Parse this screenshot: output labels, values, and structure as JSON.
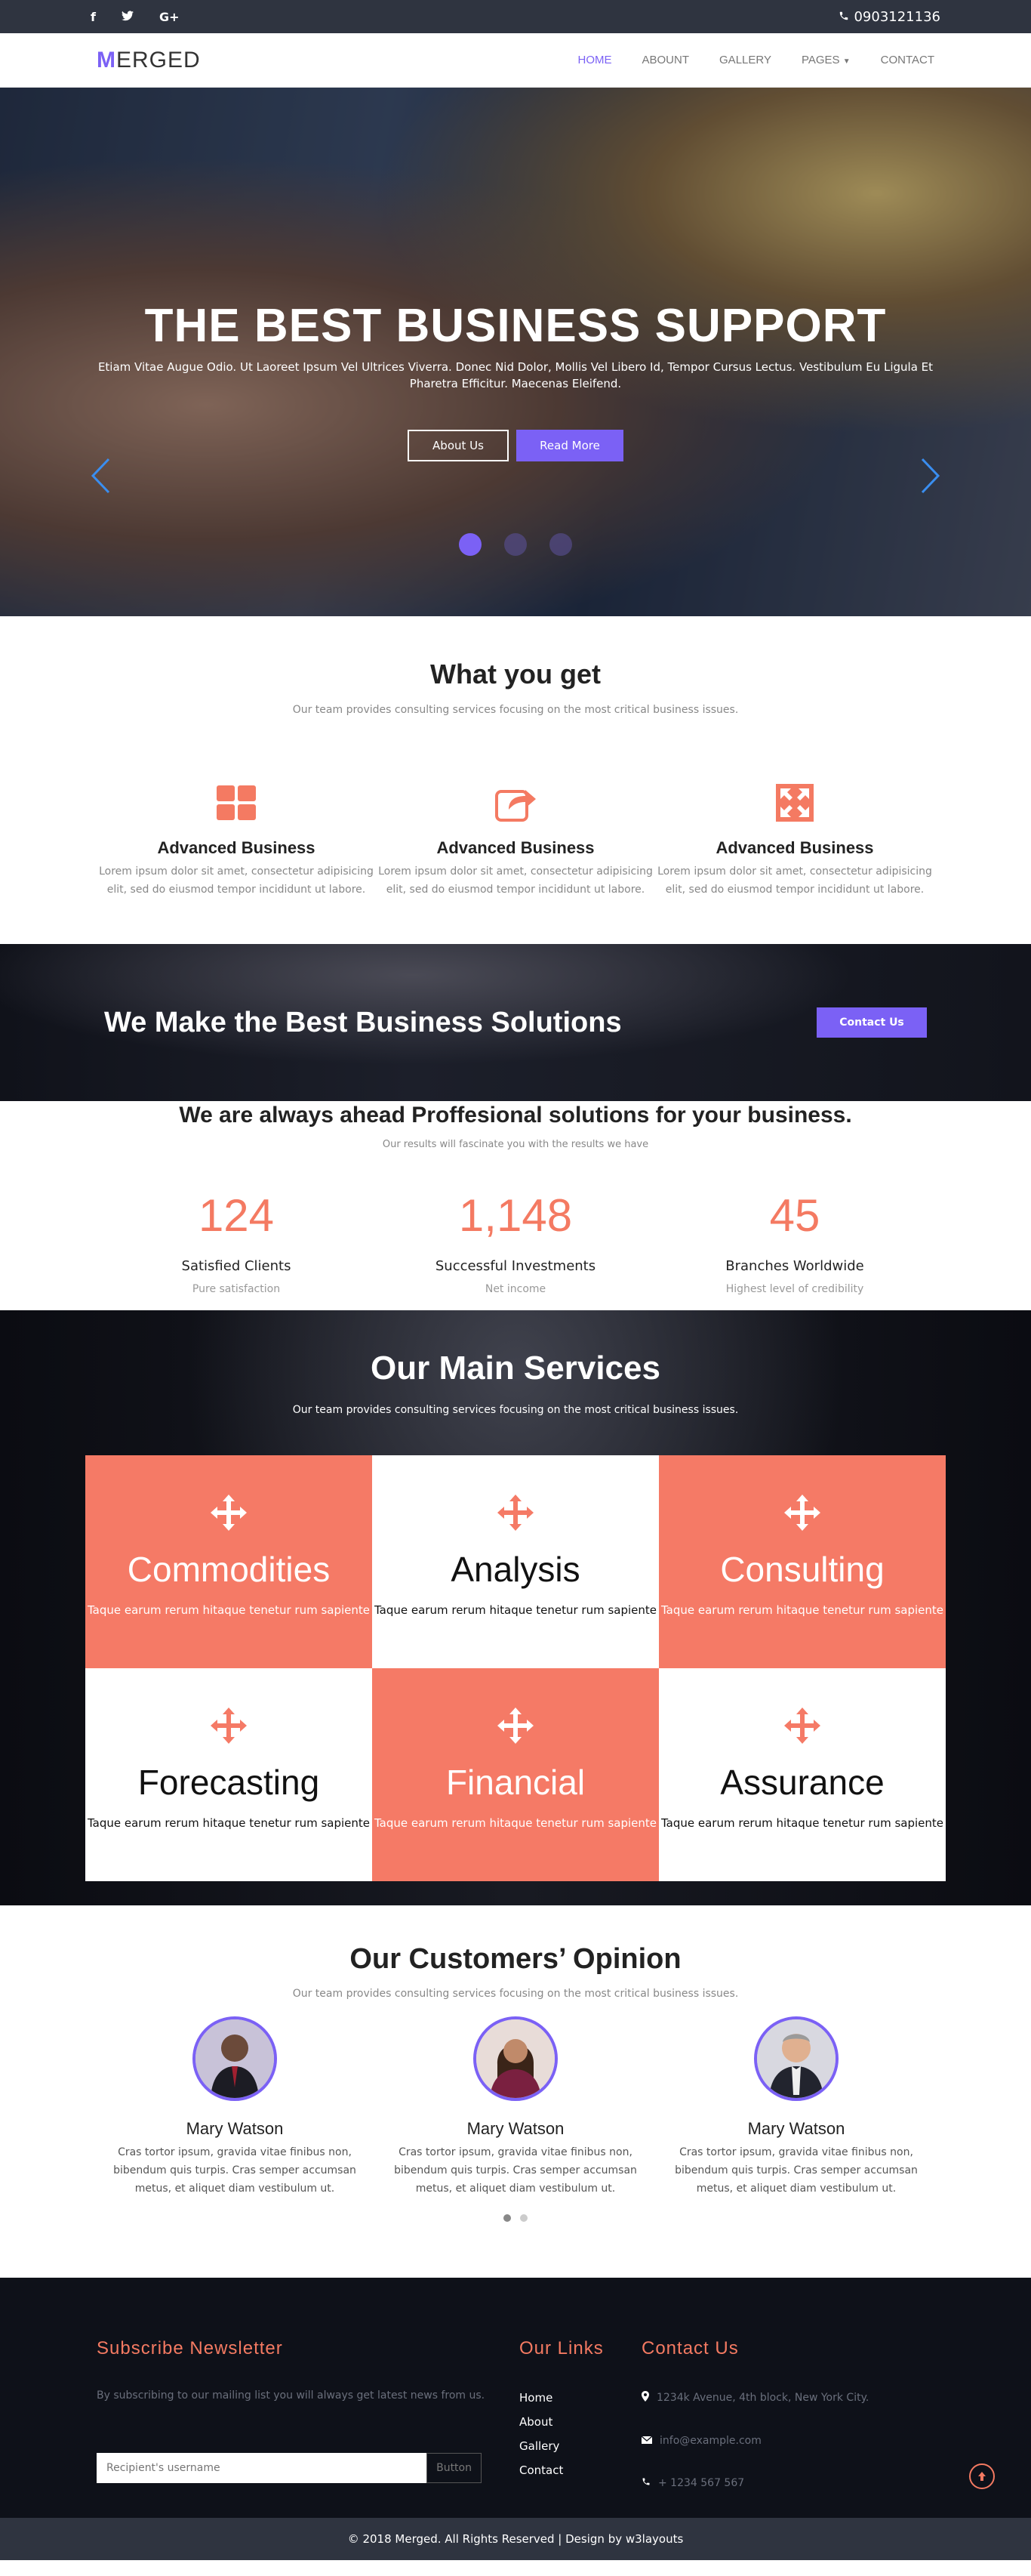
{
  "topbar": {
    "socials": [
      "f",
      "t",
      "G+"
    ],
    "phone": "0903121136"
  },
  "nav": {
    "brand_first": "M",
    "brand_rest": "ERGED",
    "items": [
      "HOME",
      "ABOUNT",
      "GALLERY",
      "PAGES",
      "CONTACT"
    ]
  },
  "hero": {
    "title": "THE BEST BUSINESS SUPPORT",
    "subtitle": "Etiam Vitae Augue Odio. Ut Laoreet Ipsum Vel Ultrices Viverra. Donec Nid Dolor, Mollis Vel Libero Id, Tempor Cursus Lectus. Vestibulum Eu Ligula Et Pharetra Efficitur. Maecenas Eleifend.",
    "btn_about": "About Us",
    "btn_read": "Read More"
  },
  "features": {
    "title": "What you get",
    "subtitle": "Our team provides consulting services focusing on the most critical business issues.",
    "items": [
      {
        "title": "Advanced Business",
        "text": "Lorem ipsum dolor sit amet, consectetur adipisicing elit, sed do eiusmod tempor incididunt ut labore."
      },
      {
        "title": "Advanced Business",
        "text": "Lorem ipsum dolor sit amet, consectetur adipisicing elit, sed do eiusmod tempor incididunt ut labore."
      },
      {
        "title": "Advanced Business",
        "text": "Lorem ipsum dolor sit amet, consectetur adipisicing elit, sed do eiusmod tempor incididunt ut labore."
      }
    ]
  },
  "banner": {
    "title": "We Make the Best Business Solutions",
    "button": "Contact Us"
  },
  "stats": {
    "title": "We are always ahead Proffesional solutions for your business.",
    "subtitle": "Our results will fascinate you with the results we have",
    "items": [
      {
        "value": "124",
        "label": "Satisfied Clients",
        "note": "Pure satisfaction"
      },
      {
        "value": "1,148",
        "label": "Successful Investments",
        "note": "Net income"
      },
      {
        "value": "45",
        "label": "Branches Worldwide",
        "note": "Highest level of credibility"
      }
    ]
  },
  "services": {
    "title": "Our Main Services",
    "subtitle": "Our team provides consulting services focusing on the most critical business issues.",
    "items": [
      {
        "title": "Commodities",
        "text": "Taque earum rerum hitaque tenetur rum sapiente"
      },
      {
        "title": "Analysis",
        "text": "Taque earum rerum hitaque tenetur rum sapiente"
      },
      {
        "title": "Consulting",
        "text": "Taque earum rerum hitaque tenetur rum sapiente"
      },
      {
        "title": "Forecasting",
        "text": "Taque earum rerum hitaque tenetur rum sapiente"
      },
      {
        "title": "Financial",
        "text": "Taque earum rerum hitaque tenetur rum sapiente"
      },
      {
        "title": "Assurance",
        "text": "Taque earum rerum hitaque tenetur rum sapiente"
      }
    ]
  },
  "testimonials": {
    "title": "Our Customers’ Opinion",
    "subtitle": "Our team provides consulting services focusing on the most critical business issues.",
    "items": [
      {
        "name": "Mary Watson",
        "text": "Cras tortor ipsum, gravida vitae finibus non, bibendum quis turpis. Cras semper accumsan metus, et aliquet diam vestibulum ut."
      },
      {
        "name": "Mary Watson",
        "text": "Cras tortor ipsum, gravida vitae finibus non, bibendum quis turpis. Cras semper accumsan metus, et aliquet diam vestibulum ut."
      },
      {
        "name": "Mary Watson",
        "text": "Cras tortor ipsum, gravida vitae finibus non, bibendum quis turpis. Cras semper accumsan metus, et aliquet diam vestibulum ut."
      }
    ]
  },
  "footer": {
    "newsletter_title": "Subscribe Newsletter",
    "newsletter_text": "By subscribing to our mailing list you will always get latest news from us.",
    "input_placeholder": "Recipient's username",
    "input_button": "Button",
    "links_title": "Our Links",
    "links": [
      "Home",
      "About",
      "Gallery",
      "Contact"
    ],
    "contact_title": "Contact Us",
    "address": "1234k Avenue, 4th block, New York City.",
    "email": "info@example.com",
    "phone": "+ 1234 567 567",
    "copyright": "© 2018 Merged. All Rights Reserved | Design by w3layouts"
  },
  "colors": {
    "accent": "#7b61f5",
    "coral": "#f57a66",
    "dark": "#2f3440"
  }
}
